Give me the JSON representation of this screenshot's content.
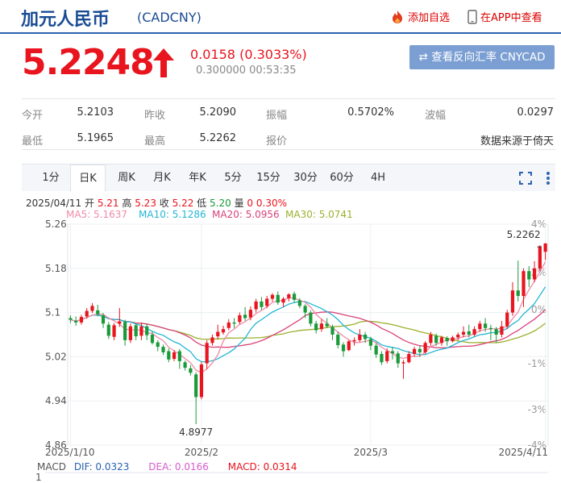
{
  "header": {
    "name": "加元人民币",
    "code": "(CADCNY)",
    "add_label": "添加自选",
    "app_label": "在APP中查看"
  },
  "quote": {
    "price": "5.2248",
    "change": "0.0158 (0.3033%)",
    "sub": "0.300000 00:53:35",
    "reverse_button": "⇄ 查看反向汇率 CNYCAD"
  },
  "stats": {
    "open_label": "今开",
    "open": "5.2103",
    "prev_close_label": "昨收",
    "prev_close": "5.2090",
    "amplitude_label": "振幅",
    "amplitude": "0.5702%",
    "volatility_label": "波幅",
    "volatility": "0.0297",
    "low_label": "最低",
    "low": "5.1965",
    "high_label": "最高",
    "high": "5.2262",
    "quote_label": "报价",
    "source": "数据来源于倚天"
  },
  "tabs": [
    "1分",
    "日K",
    "周K",
    "月K",
    "年K",
    "5分",
    "15分",
    "30分",
    "60分",
    "4H"
  ],
  "active_tab": "日K",
  "kline_info": {
    "date": "2025/04/11",
    "open_label": "开",
    "open": "5.21",
    "high_label": "高",
    "high": "5.23",
    "close_label": "收",
    "close": "5.22",
    "low_label": "低",
    "low": "5.20",
    "vol_label": "量",
    "vol": "0",
    "pct": "0.30%"
  },
  "ma_legend": {
    "ma5": "MA5: 5.1637",
    "ma10": "MA10: 5.1286",
    "ma20": "MA20: 5.0956",
    "ma30": "MA30: 5.0741"
  },
  "macd": {
    "name": "MACD",
    "dif": "DIF: 0.0323",
    "dea": "DEA: 0.0166",
    "macd": "MACD: 0.0314",
    "axis_label": "1"
  },
  "colors": {
    "up": "#e8141e",
    "down": "#1a9a3a",
    "ma5": "#f08aa8",
    "ma10": "#24b6d4",
    "ma20": "#d8437a",
    "ma30": "#9cb02e",
    "accent": "#1a4c94"
  },
  "chart_data": {
    "type": "candlestick",
    "y_ticks": [
      "5.26",
      "5.18",
      "5.1",
      "5.02",
      "4.94",
      "4.86"
    ],
    "pct_ticks": [
      "4%",
      "2%",
      "0%",
      "-1%",
      "-3%",
      "-4%"
    ],
    "x_ticks": [
      "2025/1/10",
      "2025/2",
      "2025/3",
      "2025/4/11"
    ],
    "ylim": [
      4.86,
      5.26
    ],
    "grid": true,
    "annotations": {
      "max_label": "5.2262",
      "min_label": "4.8977",
      "min_value": 4.8977,
      "max_value": 5.2262
    },
    "candles": [
      [
        5.09,
        5.087,
        5.095,
        5.081
      ],
      [
        5.085,
        5.082,
        5.093,
        5.076
      ],
      [
        5.082,
        5.092,
        5.096,
        5.078
      ],
      [
        5.093,
        5.103,
        5.108,
        5.089
      ],
      [
        5.103,
        5.112,
        5.117,
        5.099
      ],
      [
        5.104,
        5.097,
        5.114,
        5.093
      ],
      [
        5.095,
        5.08,
        5.099,
        5.072
      ],
      [
        5.078,
        5.058,
        5.083,
        5.052
      ],
      [
        5.056,
        5.077,
        5.081,
        5.05
      ],
      [
        5.08,
        5.084,
        5.108,
        5.074
      ],
      [
        5.083,
        5.05,
        5.087,
        5.04
      ],
      [
        5.05,
        5.075,
        5.08,
        5.045
      ],
      [
        5.077,
        5.057,
        5.08,
        5.05
      ],
      [
        5.058,
        5.075,
        5.082,
        5.05
      ],
      [
        5.075,
        5.059,
        5.079,
        5.05
      ],
      [
        5.06,
        5.045,
        5.065,
        5.042
      ],
      [
        5.046,
        5.038,
        5.05,
        5.03
      ],
      [
        5.038,
        5.028,
        5.042,
        5.023
      ],
      [
        5.03,
        5.015,
        5.035,
        5.01
      ],
      [
        5.016,
        5.028,
        5.032,
        5.012
      ],
      [
        5.03,
        5.012,
        5.034,
        4.998
      ],
      [
        5.01,
        5.0,
        5.013,
        4.995
      ],
      [
        4.999,
        4.991,
        5.005,
        4.986
      ],
      [
        4.988,
        4.947,
        4.992,
        4.898
      ],
      [
        4.947,
        5.006,
        5.01,
        4.943
      ],
      [
        5.008,
        5.045,
        5.05,
        4.998
      ],
      [
        5.045,
        5.055,
        5.06,
        5.04
      ],
      [
        5.057,
        5.065,
        5.078,
        5.052
      ],
      [
        5.064,
        5.07,
        5.076,
        5.06
      ],
      [
        5.072,
        5.082,
        5.088,
        5.068
      ],
      [
        5.082,
        5.08,
        5.09,
        5.072
      ],
      [
        5.083,
        5.095,
        5.1,
        5.079
      ],
      [
        5.096,
        5.09,
        5.11,
        5.085
      ],
      [
        5.091,
        5.105,
        5.111,
        5.086
      ],
      [
        5.106,
        5.12,
        5.125,
        5.1
      ],
      [
        5.12,
        5.11,
        5.128,
        5.105
      ],
      [
        5.112,
        5.125,
        5.13,
        5.108
      ],
      [
        5.125,
        5.132,
        5.135,
        5.12
      ],
      [
        5.132,
        5.118,
        5.138,
        5.114
      ],
      [
        5.118,
        5.125,
        5.128,
        5.11
      ],
      [
        5.126,
        5.133,
        5.135,
        5.12
      ],
      [
        5.134,
        5.123,
        5.138,
        5.118
      ],
      [
        5.122,
        5.112,
        5.126,
        5.108
      ],
      [
        5.112,
        5.1,
        5.115,
        5.09
      ],
      [
        5.1,
        5.08,
        5.104,
        5.075
      ],
      [
        5.08,
        5.068,
        5.085,
        5.062
      ],
      [
        5.07,
        5.08,
        5.088,
        5.065
      ],
      [
        5.08,
        5.075,
        5.09,
        5.072
      ],
      [
        5.074,
        5.06,
        5.078,
        5.05
      ],
      [
        5.06,
        5.041,
        5.065,
        5.035
      ],
      [
        5.042,
        5.03,
        5.046,
        5.02
      ],
      [
        5.032,
        5.048,
        5.05,
        5.03
      ],
      [
        5.048,
        5.05,
        5.055,
        5.04
      ],
      [
        5.05,
        5.06,
        5.07,
        5.047
      ],
      [
        5.06,
        5.052,
        5.065,
        5.045
      ],
      [
        5.052,
        5.04,
        5.056,
        5.032
      ],
      [
        5.04,
        5.024,
        5.045,
        5.018
      ],
      [
        5.025,
        5.01,
        5.03,
        5.005
      ],
      [
        5.012,
        5.03,
        5.035,
        5.008
      ],
      [
        5.03,
        5.026,
        5.038,
        5.015
      ],
      [
        5.026,
        5.008,
        5.03,
        5.0
      ],
      [
        5.008,
        5.01,
        5.014,
        4.98
      ],
      [
        5.01,
        5.025,
        5.03,
        5.008
      ],
      [
        5.025,
        5.034,
        5.038,
        5.02
      ],
      [
        5.034,
        5.028,
        5.04,
        5.02
      ],
      [
        5.028,
        5.045,
        5.048,
        5.025
      ],
      [
        5.045,
        5.06,
        5.065,
        5.04
      ],
      [
        5.058,
        5.045,
        5.062,
        5.04
      ],
      [
        5.045,
        5.055,
        5.058,
        5.04
      ],
      [
        5.054,
        5.048,
        5.057,
        5.04
      ],
      [
        5.048,
        5.055,
        5.058,
        5.046
      ],
      [
        5.055,
        5.06,
        5.064,
        5.05
      ],
      [
        5.06,
        5.065,
        5.075,
        5.055
      ],
      [
        5.066,
        5.06,
        5.078,
        5.055
      ],
      [
        5.06,
        5.07,
        5.075,
        5.057
      ],
      [
        5.07,
        5.08,
        5.085,
        5.065
      ],
      [
        5.08,
        5.072,
        5.09,
        5.065
      ],
      [
        5.072,
        5.07,
        5.078,
        5.05
      ],
      [
        5.07,
        5.06,
        5.074,
        5.045
      ],
      [
        5.06,
        5.075,
        5.085,
        5.055
      ],
      [
        5.075,
        5.1,
        5.105,
        5.07
      ],
      [
        5.1,
        5.14,
        5.155,
        5.094
      ],
      [
        5.14,
        5.13,
        5.194,
        5.12
      ],
      [
        5.13,
        5.175,
        5.18,
        5.11
      ],
      [
        5.175,
        5.16,
        5.184,
        5.146
      ],
      [
        5.16,
        5.18,
        5.193,
        5.155
      ],
      [
        5.18,
        5.22,
        5.222,
        5.175
      ],
      [
        5.21,
        5.225,
        5.226,
        5.195
      ]
    ]
  }
}
